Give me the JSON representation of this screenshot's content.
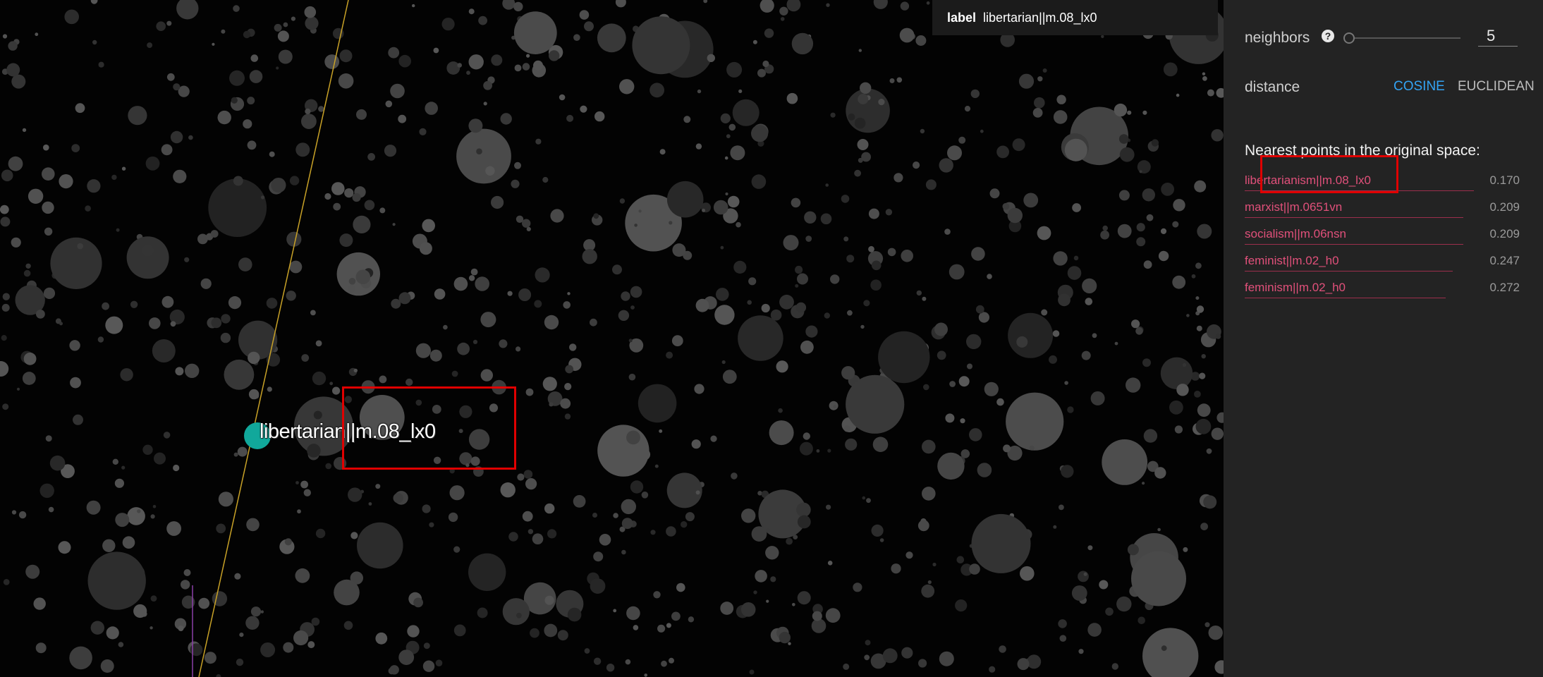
{
  "viz": {
    "selected_point_label": "libertarian||m.08_lx0",
    "colors": {
      "selected_point": "#11a89b",
      "axis_line": "#c9a227",
      "secondary_axis": "#8a3fa8"
    }
  },
  "tooltip": {
    "key": "label",
    "value": "libertarian||m.08_lx0"
  },
  "panel": {
    "neighbors": {
      "label": "neighbors",
      "help_icon": "question-mark-icon",
      "value": "5"
    },
    "distance": {
      "label": "distance",
      "options": [
        "COSINE",
        "EUCLIDEAN"
      ],
      "selected": "COSINE"
    },
    "nearest_title": "Nearest points in the original space:",
    "nearest": [
      {
        "label": "libertarianism||m.08_lx0",
        "value": "0.170"
      },
      {
        "label": "marxist||m.0651vn",
        "value": "0.209"
      },
      {
        "label": "socialism||m.06nsn",
        "value": "0.209"
      },
      {
        "label": "feminist||m.02_h0",
        "value": "0.247"
      },
      {
        "label": "feminism||m.02_h0",
        "value": "0.272"
      }
    ]
  }
}
